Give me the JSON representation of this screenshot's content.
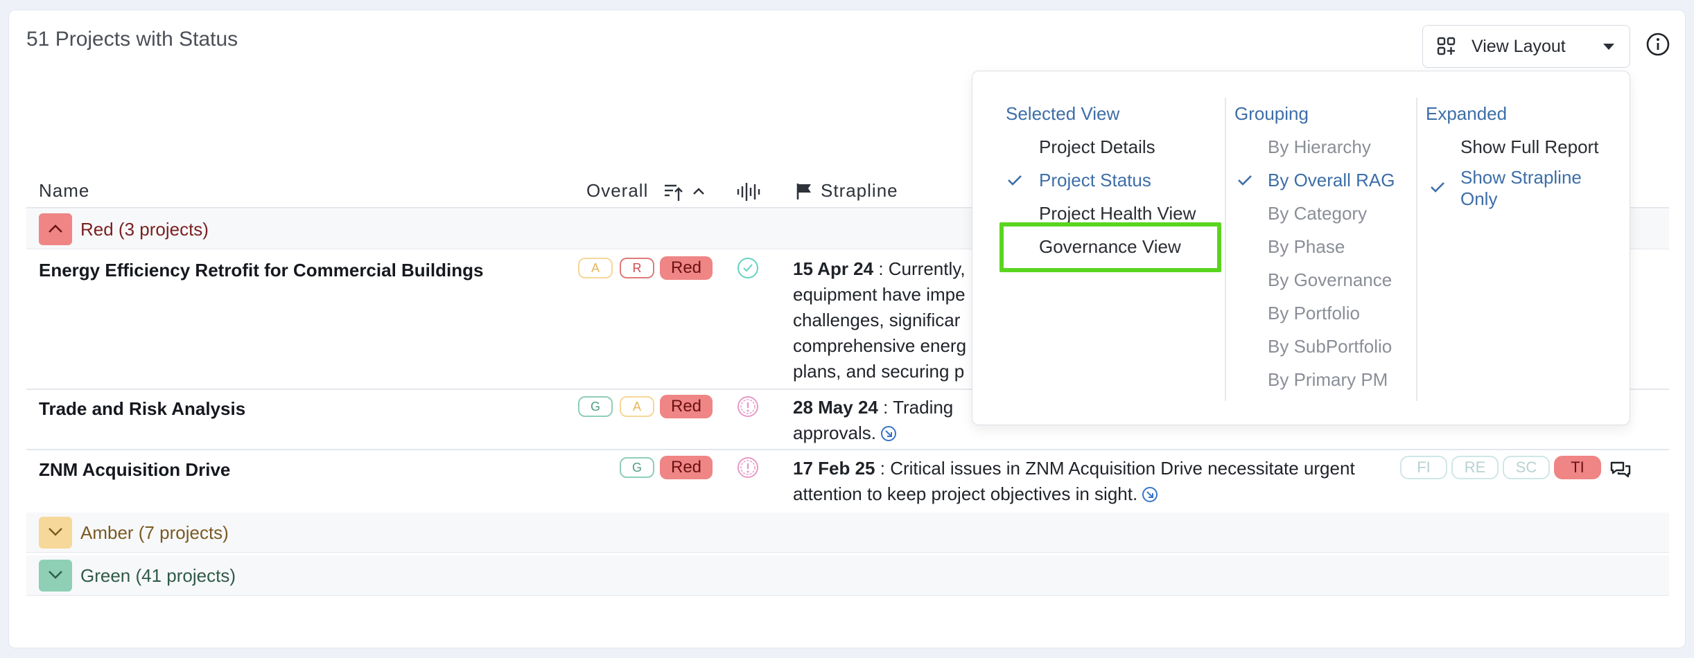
{
  "header": {
    "title": "51 Projects with Status",
    "view_layout_label": "View Layout"
  },
  "icons": {
    "view_layout": "grid-plus-icon",
    "info": "info-icon",
    "sort": "sort-ascending-icon",
    "chevron": "chevron-up-icon",
    "audio": "waveform-icon",
    "flag": "flag-icon",
    "check_status": "check-circle-icon",
    "alert_status": "alert-circle-icon",
    "link": "arrow-circle-icon",
    "comment": "comments-icon"
  },
  "table": {
    "columns": {
      "name": "Name",
      "overall": "Overall",
      "strapline": "Strapline"
    },
    "groups": [
      {
        "label": "Red (3 projects)",
        "color": "#ef8585",
        "text_color": "#7a1f1f"
      },
      {
        "label": "Amber (7 projects)",
        "color": "#f6d89a",
        "text_color": "#7a5a22"
      },
      {
        "label": "Green (41 projects)",
        "color": "#8ecfb6",
        "text_color": "#2f5a48"
      }
    ],
    "rows": [
      {
        "name": "Energy Efficiency Retrofit for Commercial Buildings",
        "pills": [
          "A",
          "R"
        ],
        "overall": "Red",
        "date": "15 Apr 24",
        "lines": [
          "Currently,",
          "equipment have impe",
          "challenges, significar",
          "comprehensive energ",
          "plans, and securing p"
        ]
      },
      {
        "name": "Trade and Risk Analysis",
        "pills": [
          "G",
          "A"
        ],
        "overall": "Red",
        "date": "28 May 24",
        "lines": [
          "Trading",
          "approvals."
        ]
      },
      {
        "name": "ZNM Acquisition Drive",
        "pills": [
          "G"
        ],
        "overall": "Red",
        "date": "17 Feb 25",
        "lines": [
          "Critical issues in ZNM Acquisition Drive necessitate urgent",
          "attention to keep project objectives in sight."
        ],
        "tags": [
          "FI",
          "RE",
          "SC",
          "TI"
        ]
      }
    ]
  },
  "dropdown": {
    "selected_view": {
      "heading": "Selected View",
      "options": [
        "Project Details",
        "Project Status",
        "Project Health View",
        "Governance View"
      ],
      "checked": 1
    },
    "grouping": {
      "heading": "Grouping",
      "options": [
        "By Hierarchy",
        "By Overall RAG",
        "By Category",
        "By Phase",
        "By Governance",
        "By Portfolio",
        "By SubPortfolio",
        "By Primary PM"
      ],
      "checked": 1
    },
    "expanded": {
      "heading": "Expanded",
      "options": [
        "Show Full Report",
        "Show Strapline",
        "Only"
      ],
      "checked": 1
    }
  },
  "colors": {
    "accent_blue": "#3d6ea8",
    "red": "#ef8585",
    "highlight": "#5ad51e"
  }
}
